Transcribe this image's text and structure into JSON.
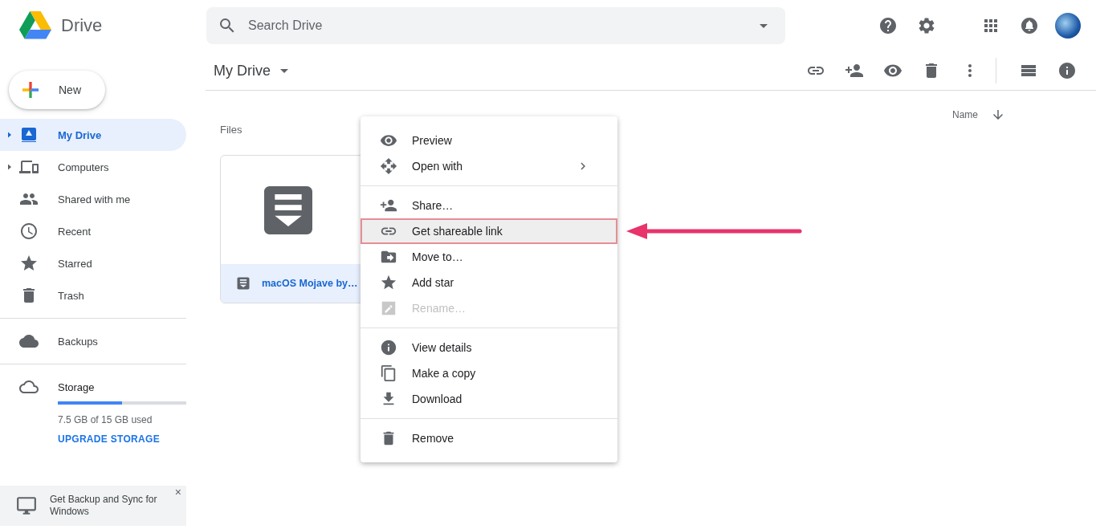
{
  "app": {
    "name": "Drive"
  },
  "search": {
    "placeholder": "Search Drive"
  },
  "new_button": {
    "label": "New"
  },
  "nav_sections": [
    [
      {
        "label": "My Drive",
        "selected": true,
        "expandable": true
      },
      {
        "label": "Computers",
        "selected": false,
        "expandable": true
      },
      {
        "label": "Shared with me",
        "selected": false,
        "expandable": false
      },
      {
        "label": "Recent",
        "selected": false,
        "expandable": false
      },
      {
        "label": "Starred",
        "selected": false,
        "expandable": false
      },
      {
        "label": "Trash",
        "selected": false,
        "expandable": false
      }
    ],
    [
      {
        "label": "Backups",
        "selected": false,
        "expandable": false
      }
    ]
  ],
  "storage": {
    "label": "Storage",
    "level": 0.5,
    "usage": "7.5 GB of 15 GB used",
    "action": "UPGRADE STORAGE"
  },
  "banner": {
    "text": "Get Backup and Sync for Windows",
    "close": "×"
  },
  "breadcrumb": {
    "label": "My Drive"
  },
  "sort": {
    "label": "Name"
  },
  "section_title": "Files",
  "files": [
    {
      "name": "macOS Mojave by…",
      "selected": true
    }
  ],
  "context_menu": {
    "groups": [
      [
        {
          "label": "Preview",
          "disabled": false,
          "highlighted": false,
          "submenu": false
        },
        {
          "label": "Open with",
          "disabled": false,
          "highlighted": false,
          "submenu": true
        }
      ],
      [
        {
          "label": "Share…",
          "disabled": false,
          "highlighted": false,
          "submenu": false
        },
        {
          "label": "Get shareable link",
          "disabled": false,
          "highlighted": true,
          "submenu": false
        },
        {
          "label": "Move to…",
          "disabled": false,
          "highlighted": false,
          "submenu": false
        },
        {
          "label": "Add star",
          "disabled": false,
          "highlighted": false,
          "submenu": false
        },
        {
          "label": "Rename…",
          "disabled": true,
          "highlighted": false,
          "submenu": false
        }
      ],
      [
        {
          "label": "View details",
          "disabled": false,
          "highlighted": false,
          "submenu": false
        },
        {
          "label": "Make a copy",
          "disabled": false,
          "highlighted": false,
          "submenu": false
        },
        {
          "label": "Download",
          "disabled": false,
          "highlighted": false,
          "submenu": false
        }
      ],
      [
        {
          "label": "Remove",
          "disabled": false,
          "highlighted": false,
          "submenu": false
        }
      ]
    ]
  }
}
